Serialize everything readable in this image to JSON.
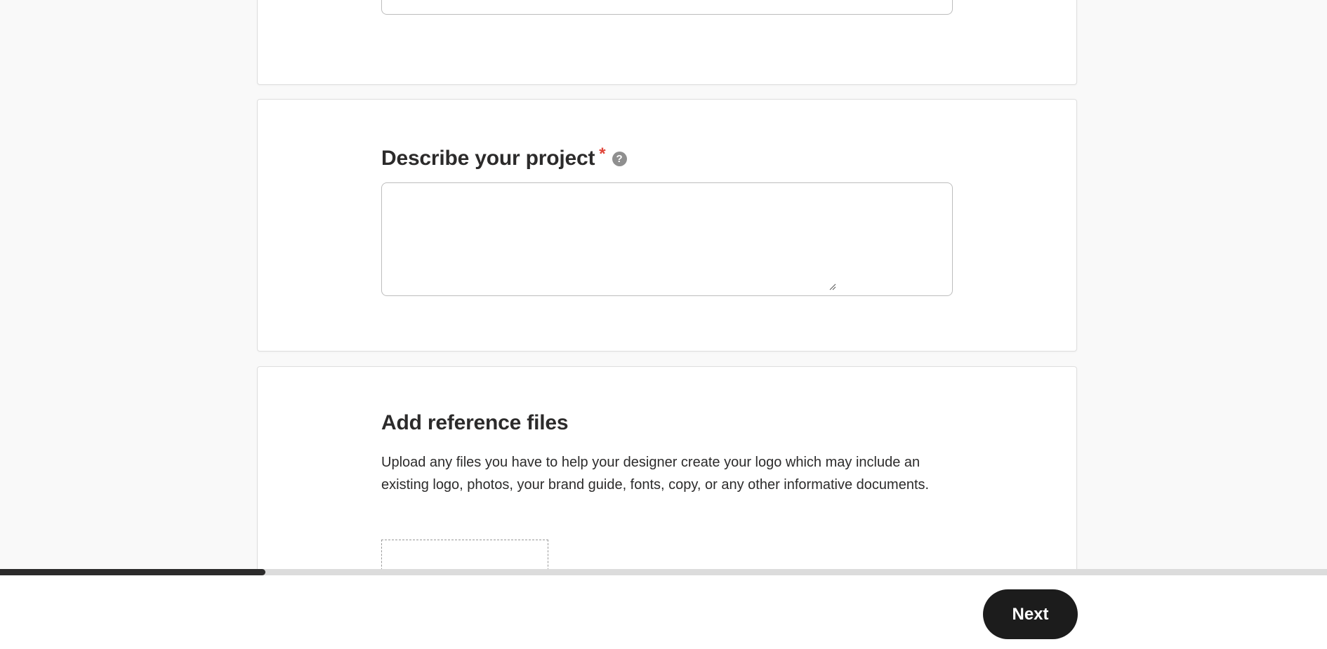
{
  "form": {
    "project_description": {
      "label": "Describe your project",
      "required_mark": "*",
      "help_icon": "question-circle-icon",
      "value": "",
      "placeholder": ""
    },
    "reference_files": {
      "title": "Add reference files",
      "description": "Upload any files you have to help your designer create your logo which may include an existing logo, photos, your brand guide, fonts, copy, or any other informative documents."
    }
  },
  "progress": {
    "fraction": 0.2
  },
  "footer": {
    "next_label": "Next"
  },
  "colors": {
    "required": "#e0453a",
    "button_bg": "#1c1c1c",
    "progress_fill": "#2c2b2b",
    "progress_track": "#dcdcdc"
  }
}
